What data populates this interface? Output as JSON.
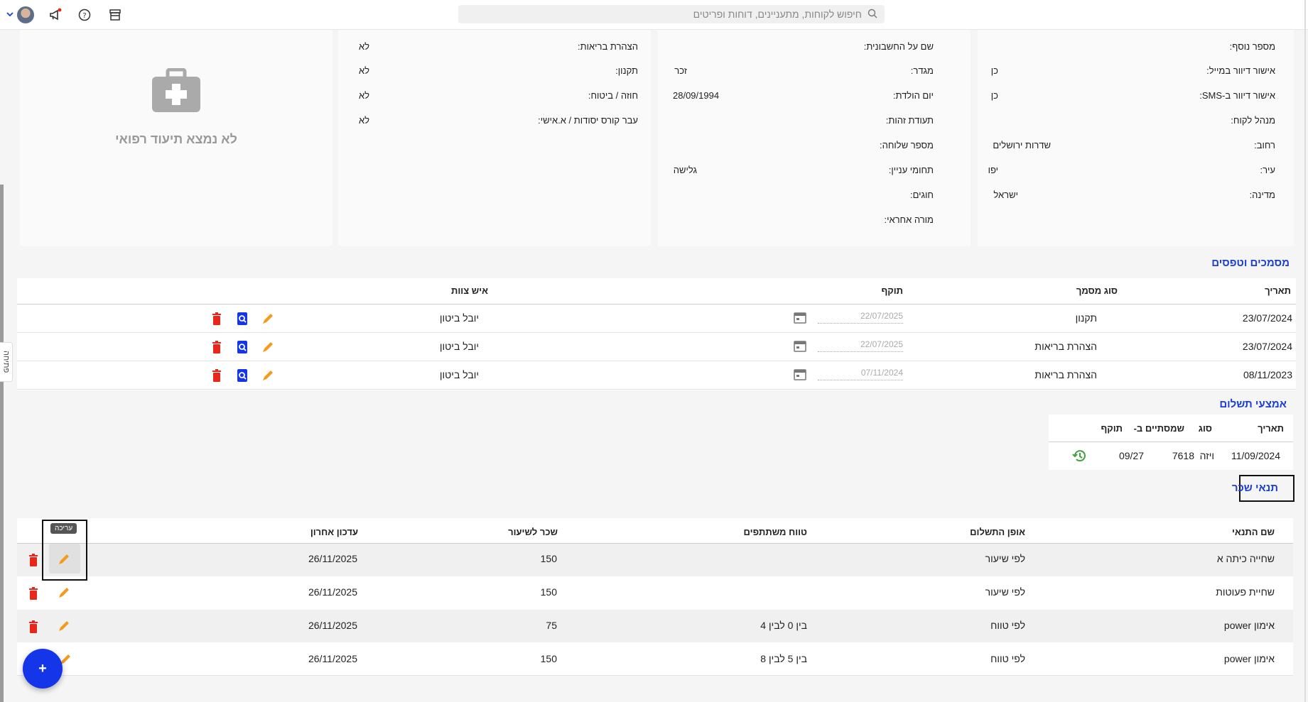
{
  "topbar": {
    "search_placeholder": "חיפוש לקוחות, מתעניינים, דוחות ופריטים",
    "icons": [
      "store-icon",
      "help-icon",
      "megaphone-icon",
      "avatar",
      "chevron-down-icon"
    ]
  },
  "side_tab": {
    "label": "פתיחה"
  },
  "card_address": {
    "rows": [
      {
        "label": "מספר נוסף:",
        "value": ""
      },
      {
        "label": "אישור דיוור במייל:",
        "value": "כן"
      },
      {
        "label": "אישור דיוור ב-SMS:",
        "value": "כן"
      },
      {
        "label": "מנהל לקוח:",
        "value": ""
      },
      {
        "label": "רחוב:",
        "value": "שדרות ירושלים"
      },
      {
        "label": "עיר:",
        "value": "יפו"
      },
      {
        "label": "מדינה:",
        "value": "ישראל"
      }
    ]
  },
  "card_personal": {
    "rows": [
      {
        "label": "שם על החשבונית:",
        "value": ""
      },
      {
        "label": "מגדר:",
        "value": "זכר"
      },
      {
        "label": "יום הולדת:",
        "value": "28/09/1994"
      },
      {
        "label": "תעודת זהות:",
        "value": ""
      },
      {
        "label": "מספר שלוחה:",
        "value": ""
      },
      {
        "label": "תחומי עניין:",
        "value": "גלישה"
      },
      {
        "label": "חוגים:",
        "value": ""
      },
      {
        "label": "מורה אחראי:",
        "value": ""
      }
    ]
  },
  "card_health": {
    "rows": [
      {
        "label": "הצהרת בריאות:",
        "value": "לא"
      },
      {
        "label": "תקנון:",
        "value": "לא"
      },
      {
        "label": "חוזה / ביטוח:",
        "value": "לא"
      },
      {
        "label": "עבר קורס יסודות / א.אישי:",
        "value": "לא"
      }
    ]
  },
  "medical": {
    "empty_text": "לא נמצא תיעוד רפואי"
  },
  "documents": {
    "title": "מסמכים וטפסים",
    "headers": {
      "date": "תאריך",
      "type": "סוג מסמך",
      "validity": "תוקף",
      "staff": "איש צוות"
    },
    "rows": [
      {
        "date": "23/07/2024",
        "type": "תקנון",
        "validity": "22/07/2025",
        "staff": "יובל ביטון"
      },
      {
        "date": "23/07/2024",
        "type": "הצהרת בריאות",
        "validity": "22/07/2025",
        "staff": "יובל ביטון"
      },
      {
        "date": "08/11/2023",
        "type": "הצהרת בריאות",
        "validity": "07/11/2024",
        "staff": "יובל ביטון"
      }
    ]
  },
  "payments": {
    "title": "אמצעי תשלום",
    "headers": {
      "date": "תאריך",
      "type": "סוג",
      "digits": "שמסתיים ב-",
      "validity": "תוקף"
    },
    "rows": [
      {
        "date": "11/09/2024",
        "type": "ויזה",
        "digits": "7618",
        "validity": "09/27"
      }
    ]
  },
  "wage": {
    "title": "תנאי שכר",
    "tooltip": "עריכה",
    "headers": {
      "name": "שם התנאי",
      "method": "אופן התשלום",
      "range": "טווח משתתפים",
      "rate": "שכר לשיעור",
      "updated": "עדכון אחרון"
    },
    "rows": [
      {
        "name": "שחייה כיתה א",
        "method": "לפי שיעור",
        "range": "",
        "rate": "150",
        "updated": "26/11/2025"
      },
      {
        "name": "שחיית פעוטות",
        "method": "לפי שיעור",
        "range": "",
        "rate": "150",
        "updated": "26/11/2025"
      },
      {
        "name": "אימון power",
        "method": "לפי טווח",
        "range": "בין 0 לבין 4",
        "rate": "75",
        "updated": "26/11/2025"
      },
      {
        "name": "אימון power",
        "method": "לפי טווח",
        "range": "בין 5 לבין 8",
        "rate": "150",
        "updated": "26/11/2025"
      }
    ]
  },
  "fab": {
    "label": "+"
  },
  "colors": {
    "accent": "#1a3fd6",
    "delete": "#e8261b",
    "edit": "#f49a1c",
    "view": "#1435e8",
    "history": "#3ea33e"
  }
}
